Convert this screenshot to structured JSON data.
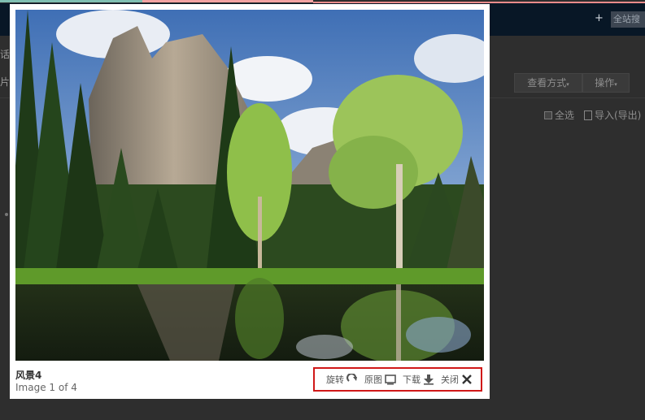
{
  "background": {
    "plus_symbol": "+",
    "search_text": "全站搜",
    "side_text_1": "话",
    "side_text_2": "片",
    "view_button": "查看方式",
    "ops_button": "操作",
    "select_all": "全选",
    "import_export": "导入(导出)"
  },
  "lightbox": {
    "title": "风景4",
    "counter": "Image 1 of 4",
    "rotate_label": "旋转",
    "original_label": "原图",
    "download_label": "下载",
    "close_label": "关闭",
    "icons": {
      "rotate": "rotate-clockwise-icon",
      "original": "monitor-icon",
      "download": "download-arrow-icon",
      "close": "close-x-icon"
    },
    "highlight_color": "#d01818"
  }
}
